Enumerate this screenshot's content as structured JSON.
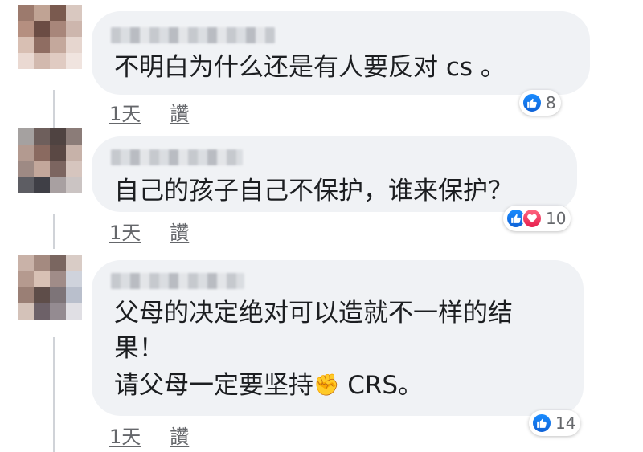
{
  "comments": [
    {
      "text_lines": [
        "不明白为什么还是有人要反对 cs 。"
      ],
      "reaction_count": "8",
      "reactions": [
        "like"
      ],
      "time": "1天",
      "reply_label": "讚"
    },
    {
      "text_lines": [
        "自己的孩子自己不保护，谁来保护？"
      ],
      "reaction_count": "10",
      "reactions": [
        "like",
        "love"
      ],
      "time": "1天",
      "reply_label": "讚"
    },
    {
      "text_lines": [
        "父母的决定绝对可以造就不一样的结",
        "果！"
      ],
      "text_line3_before": "请父母一定要坚持",
      "text_line3_emoji": "✊",
      "text_line3_after": " CRS。",
      "reaction_count": "14",
      "reactions": [
        "like"
      ],
      "time": "1天",
      "reply_label": "讚"
    }
  ],
  "colors": {
    "bubble": "#f0f2f5",
    "like": "#1877f2",
    "love": "#f33e58",
    "meta_text": "#65676b",
    "thread_line": "#d0d3d8"
  },
  "icons": {
    "like": "like-thumb-icon",
    "love": "love-heart-icon"
  }
}
